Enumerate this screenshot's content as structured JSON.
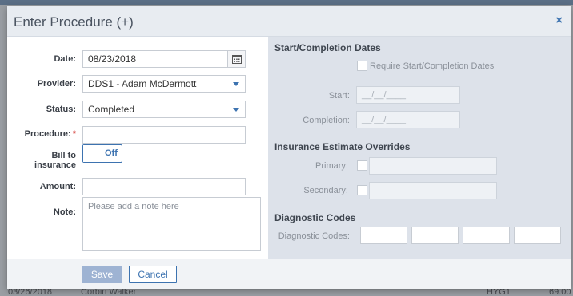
{
  "modal": {
    "title": "Enter Procedure (+)",
    "close_symbol": "×"
  },
  "form": {
    "date": {
      "label": "Date:",
      "value": "08/23/2018"
    },
    "provider": {
      "label": "Provider:",
      "value": "DDS1 - Adam McDermott"
    },
    "status": {
      "label": "Status:",
      "value": "Completed"
    },
    "procedure": {
      "label": "Procedure:",
      "required_mark": "*",
      "value": ""
    },
    "bill_to_insurance": {
      "label_line1": "Bill to",
      "label_line2": "insurance",
      "state": "Off"
    },
    "amount": {
      "label": "Amount:",
      "value": ""
    },
    "note": {
      "label": "Note:",
      "placeholder": "Please add a note here"
    }
  },
  "dates_section": {
    "title": "Start/Completion Dates",
    "require_label": "Require Start/Completion Dates",
    "start_label": "Start:",
    "start_placeholder": "__/__/____",
    "completion_label": "Completion:",
    "completion_placeholder": "__/__/____"
  },
  "insurance_section": {
    "title": "Insurance Estimate Overrides",
    "primary_label": "Primary:",
    "secondary_label": "Secondary:"
  },
  "diagnostic_section": {
    "title": "Diagnostic Codes",
    "codes_label": "Diagnostic Codes:"
  },
  "footer": {
    "save_label": "Save",
    "cancel_label": "Cancel"
  },
  "background": {
    "row_date": "03/26/2018",
    "row_name": "Corbin Walker",
    "row_code": "HYG1",
    "row_amount": "69.00"
  },
  "colors": {
    "accent": "#3d73b0",
    "required": "#d9534f",
    "right_pane": "#dde2ea"
  }
}
